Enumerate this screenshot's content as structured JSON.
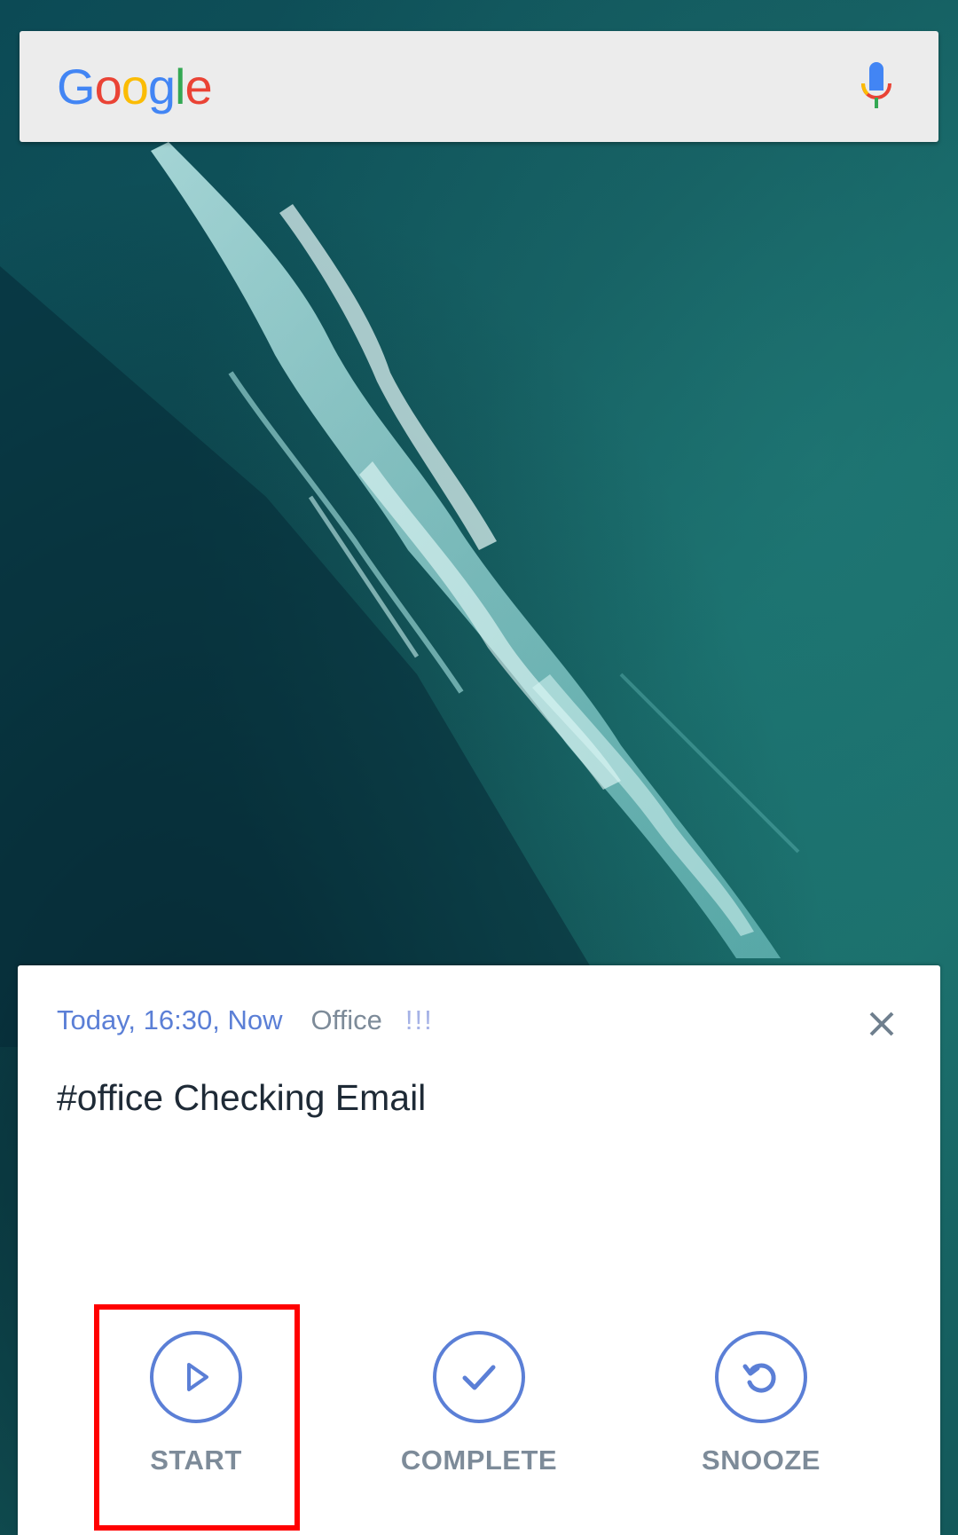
{
  "search_bar": {
    "logo_letters": [
      {
        "char": "G",
        "color": "#4285F4"
      },
      {
        "char": "o",
        "color": "#EA4335"
      },
      {
        "char": "o",
        "color": "#FBBC05"
      },
      {
        "char": "g",
        "color": "#4285F4"
      },
      {
        "char": "l",
        "color": "#34A853"
      },
      {
        "char": "e",
        "color": "#EA4335"
      }
    ],
    "mic_icon": "mic-icon"
  },
  "card": {
    "meta": {
      "date": "Today, 16:30, Now",
      "project": "Office",
      "priority": "!!!"
    },
    "title": "#office Checking Email",
    "close_icon": "close-icon",
    "actions": [
      {
        "label": "START",
        "icon": "play-icon"
      },
      {
        "label": "COMPLETE",
        "icon": "check-icon"
      },
      {
        "label": "SNOOZE",
        "icon": "snooze-icon"
      }
    ]
  },
  "colors": {
    "accent": "#5b7fd6",
    "muted_text": "#7d8b99",
    "highlight": "#ff0000"
  }
}
